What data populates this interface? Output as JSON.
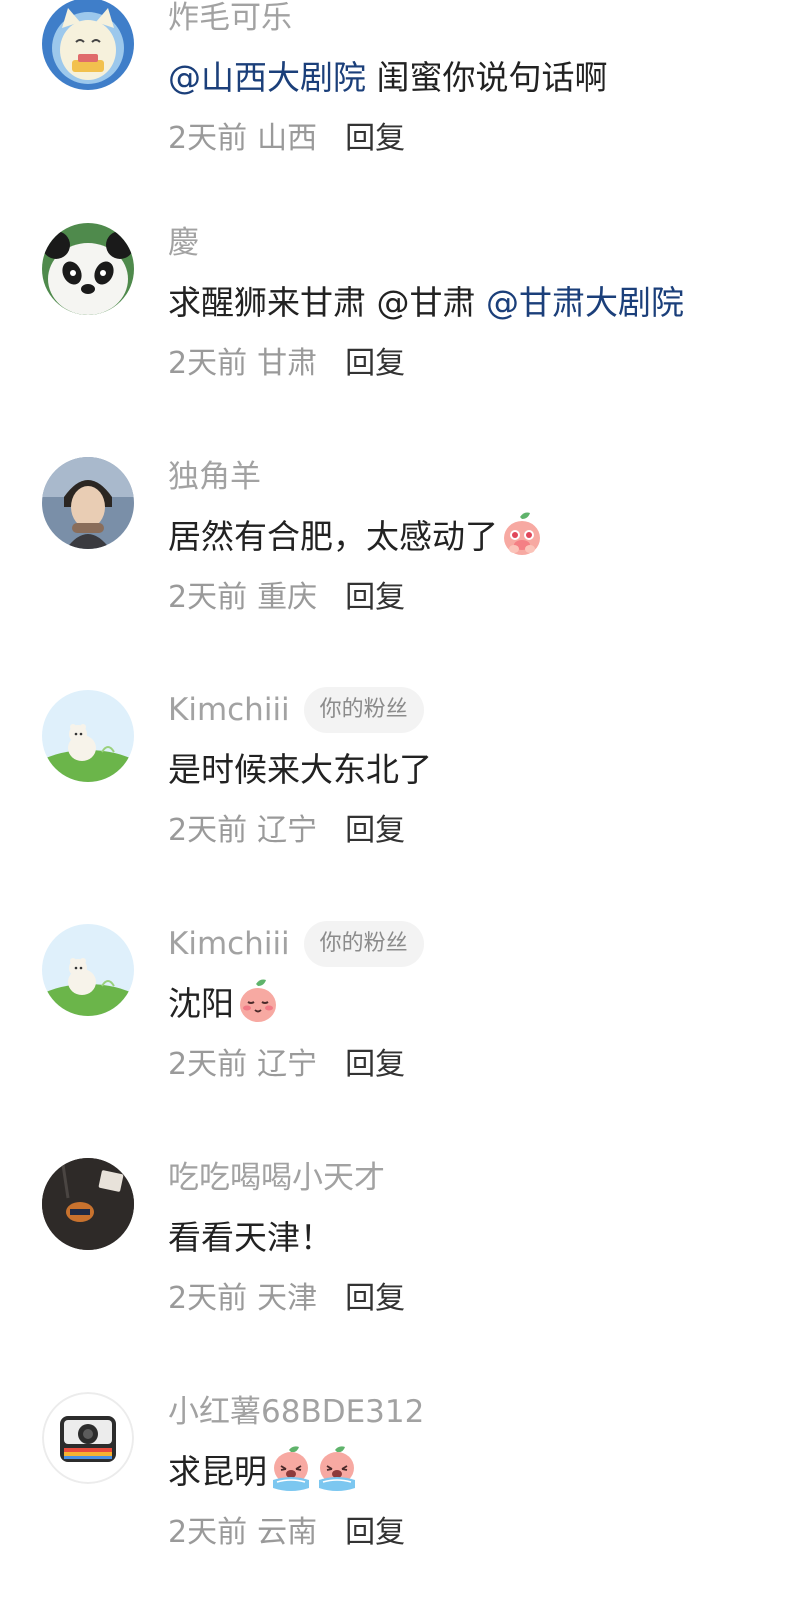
{
  "comments": [
    {
      "username": "炸毛可乐",
      "badge": "",
      "segments": [
        {
          "type": "mention",
          "text": "@山西大剧院"
        },
        {
          "type": "text",
          "text": " 闺蜜你说句话啊"
        }
      ],
      "emojis": [],
      "time": "2天前",
      "location": "山西",
      "reply_label": "回复",
      "avatar_icon": "cartoon-cat-avatar"
    },
    {
      "username": "慶",
      "badge": "",
      "segments": [
        {
          "type": "text",
          "text": "求醒狮来甘肃 @甘肃 "
        },
        {
          "type": "mention",
          "text": "@甘肃大剧院"
        }
      ],
      "emojis": [],
      "time": "2天前",
      "location": "甘肃",
      "reply_label": "回复",
      "avatar_icon": "panda-avatar"
    },
    {
      "username": "独角羊",
      "badge": "",
      "segments": [
        {
          "type": "text",
          "text": "居然有合肥，太感动了"
        }
      ],
      "emojis": [
        "touched-peach-emoji"
      ],
      "time": "2天前",
      "location": "重庆",
      "reply_label": "回复",
      "avatar_icon": "person-photo-avatar"
    },
    {
      "username": "Kimchiii",
      "badge": "你的粉丝",
      "segments": [
        {
          "type": "text",
          "text": "是时候来大东北了"
        }
      ],
      "emojis": [],
      "time": "2天前",
      "location": "辽宁",
      "reply_label": "回复",
      "avatar_icon": "bear-on-hill-avatar"
    },
    {
      "username": "Kimchiii",
      "badge": "你的粉丝",
      "segments": [
        {
          "type": "text",
          "text": "沈阳"
        }
      ],
      "emojis": [
        "shy-peach-emoji"
      ],
      "time": "2天前",
      "location": "辽宁",
      "reply_label": "回复",
      "avatar_icon": "bear-on-hill-avatar"
    },
    {
      "username": "吃吃喝喝小天才",
      "badge": "",
      "segments": [
        {
          "type": "text",
          "text": "看看天津！"
        }
      ],
      "emojis": [],
      "time": "2天前",
      "location": "天津",
      "reply_label": "回复",
      "avatar_icon": "dark-shirt-avatar"
    },
    {
      "username": "小红薯68BDE312",
      "badge": "",
      "segments": [
        {
          "type": "text",
          "text": "求昆明"
        }
      ],
      "emojis": [
        "crying-peach-emoji",
        "crying-peach-emoji"
      ],
      "time": "2天前",
      "location": "云南",
      "reply_label": "回复",
      "avatar_icon": "camera-avatar"
    }
  ],
  "colors": {
    "username": "#a2a2a2",
    "mention": "#1b3f7a",
    "text": "#222222",
    "meta": "#9a9a9a",
    "badge_bg": "#f3f3f3"
  }
}
